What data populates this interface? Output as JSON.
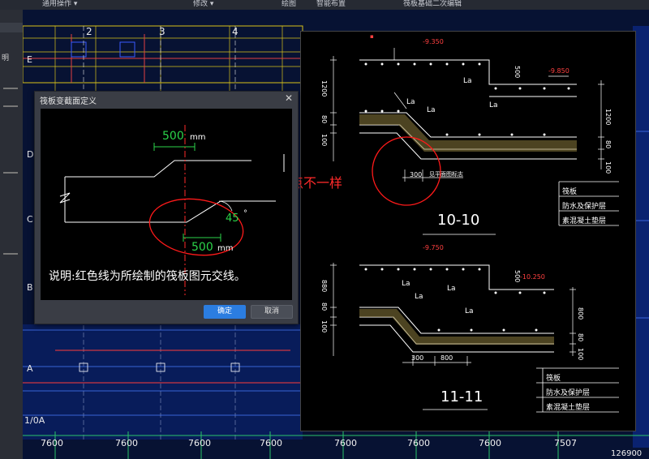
{
  "menubar": {
    "items": [
      "通用操作 ▾",
      "修改 ▾",
      "绘图",
      "智能布置",
      "筏板基础二次编辑"
    ]
  },
  "leftpanel": {
    "labels": [
      "明"
    ]
  },
  "axes": {
    "columns": [
      "2",
      "3",
      "4"
    ],
    "rows": [
      "E",
      "D",
      "C",
      "B",
      "A",
      "1/0A"
    ]
  },
  "dialog": {
    "title": "筏板变截面定义",
    "dim_top": "500",
    "dim_top_unit": "mm",
    "dim_bottom": "500",
    "dim_bottom_unit": "mm",
    "angle": "45",
    "angle_unit": "°",
    "explanation": "说明:红色线为所绘制的筏板图元交线。",
    "ok": "确定",
    "cancel": "取消"
  },
  "annotation": {
    "note": "这两个节点不一样"
  },
  "detail": {
    "section1": {
      "title": "10-10",
      "elev_top": "-9.350",
      "elev_step": "-9.850",
      "rebar_labels": [
        "La",
        "La",
        "La",
        "La"
      ],
      "dims_left": [
        "1200",
        "80",
        "100"
      ],
      "dims_right": [
        "500",
        "1200",
        "80",
        "100"
      ],
      "dim_bottom": "300",
      "note": "见平面图标志",
      "layers": [
        "筏板",
        "防水及保护层",
        "素混凝土垫层"
      ]
    },
    "section2": {
      "title": "11-11",
      "elev_top": "-9.750",
      "elev_step": "-10.250",
      "rebar_labels": [
        "La",
        "La",
        "La",
        "La"
      ],
      "dims_left": [
        "880",
        "80",
        "100"
      ],
      "dims_right": [
        "500",
        "800",
        "80",
        "100"
      ],
      "dims_bottom": [
        "300",
        "800"
      ],
      "layers": [
        "筏板",
        "防水及保护层",
        "素混凝土垫层"
      ]
    }
  },
  "bottom_dims": {
    "values": [
      "7600",
      "7600",
      "7600",
      "7600",
      "7600",
      "7600",
      "7600",
      "7507"
    ],
    "total": "126900"
  }
}
